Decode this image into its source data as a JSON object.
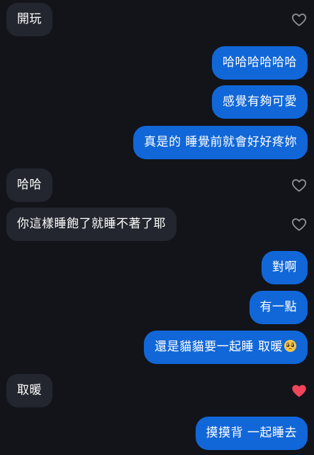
{
  "colors": {
    "background": "#12141a",
    "incoming_bubble": "#23262e",
    "outgoing_bubble": "#1167d8",
    "heart_outline": "#8e9098",
    "heart_liked": "#f2445a"
  },
  "messages": [
    {
      "direction": "incoming",
      "text": "開玩",
      "reaction": "heart-outline-icon"
    },
    {
      "direction": "outgoing",
      "text": "哈哈哈哈哈哈"
    },
    {
      "direction": "outgoing",
      "text": "感覺有夠可愛"
    },
    {
      "direction": "outgoing",
      "text": "真是的 睡覺前就會好好疼妳"
    },
    {
      "direction": "incoming",
      "text": "哈哈",
      "reaction": "heart-outline-icon"
    },
    {
      "direction": "incoming",
      "text": "你這樣睡飽了就睡不著了耶",
      "reaction": "heart-outline-icon"
    },
    {
      "direction": "outgoing",
      "text": "對啊"
    },
    {
      "direction": "outgoing",
      "text": "有一點"
    },
    {
      "direction": "outgoing",
      "text": "還是貓貓要一起睡 取暖",
      "emoji": "pleading-face-emoji"
    },
    {
      "direction": "incoming",
      "text": "取暖",
      "reaction": "heart-filled-icon"
    },
    {
      "direction": "outgoing",
      "text": "摸摸背 一起睡去"
    }
  ]
}
